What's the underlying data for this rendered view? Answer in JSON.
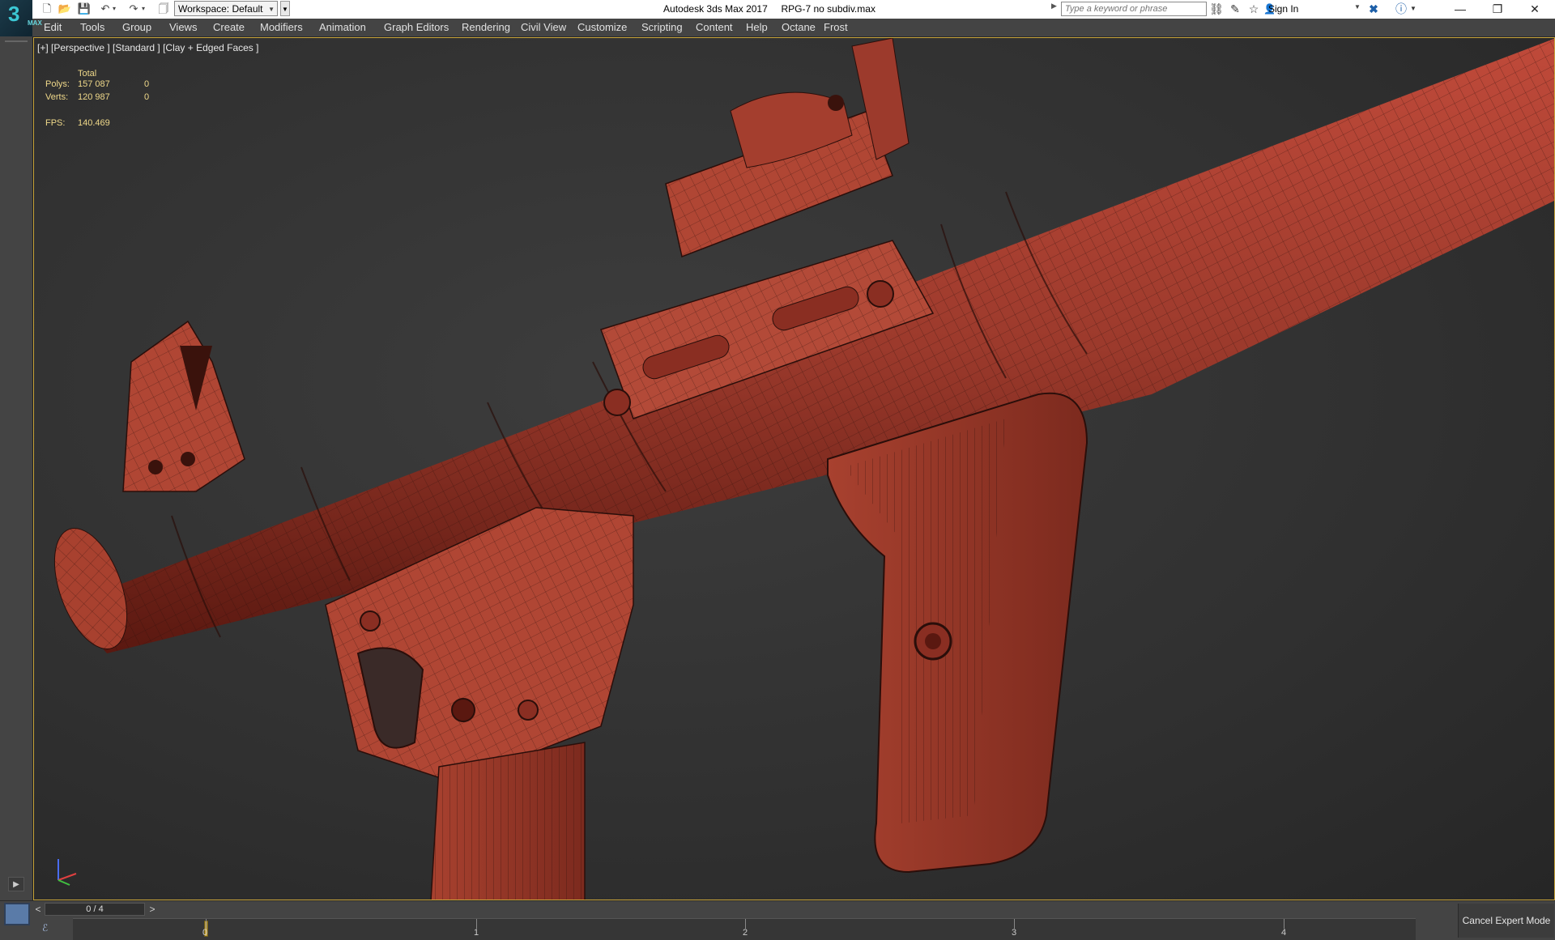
{
  "titlebar": {
    "app_logo": "3",
    "app_logo_sub": "MAX",
    "workspace": "Workspace: Default",
    "window_title": "Autodesk 3ds Max 2017     RPG-7 no subdiv.max",
    "search_placeholder": "Type a keyword or phrase",
    "sign_in": "Sign In",
    "window_controls": [
      "—",
      "❐",
      "✕"
    ]
  },
  "menu": {
    "items": [
      "Edit",
      "Tools",
      "Group",
      "Views",
      "Create",
      "Modifiers",
      "Animation",
      "Graph Editors",
      "Rendering",
      "Civil View",
      "Customize",
      "Scripting",
      "Content",
      "Help",
      "Octane",
      "Frost"
    ]
  },
  "viewport": {
    "label": "[+] [Perspective ] [Standard ] [Clay + Edged Faces ]",
    "stats": {
      "total_header": "Total",
      "polys_label": "Polys:",
      "polys_total": "157 087",
      "polys_selected": "0",
      "verts_label": "Verts:",
      "verts_total": "120 987",
      "verts_selected": "0",
      "fps_label": "FPS:",
      "fps_value": "140.469"
    },
    "model_color": "#9c3a2c",
    "wire_color": "#2a0e0a"
  },
  "timeline": {
    "frame_display": "0 / 4",
    "ticks": [
      "0",
      "1",
      "2",
      "3",
      "4"
    ],
    "current_frame": 0,
    "total_frames": 4,
    "cancel_expert": "Cancel Expert Mode"
  },
  "colors": {
    "viewport_border": "#c8a43a",
    "stats_text": "#f0d98a",
    "ui_dark": "#444444"
  }
}
